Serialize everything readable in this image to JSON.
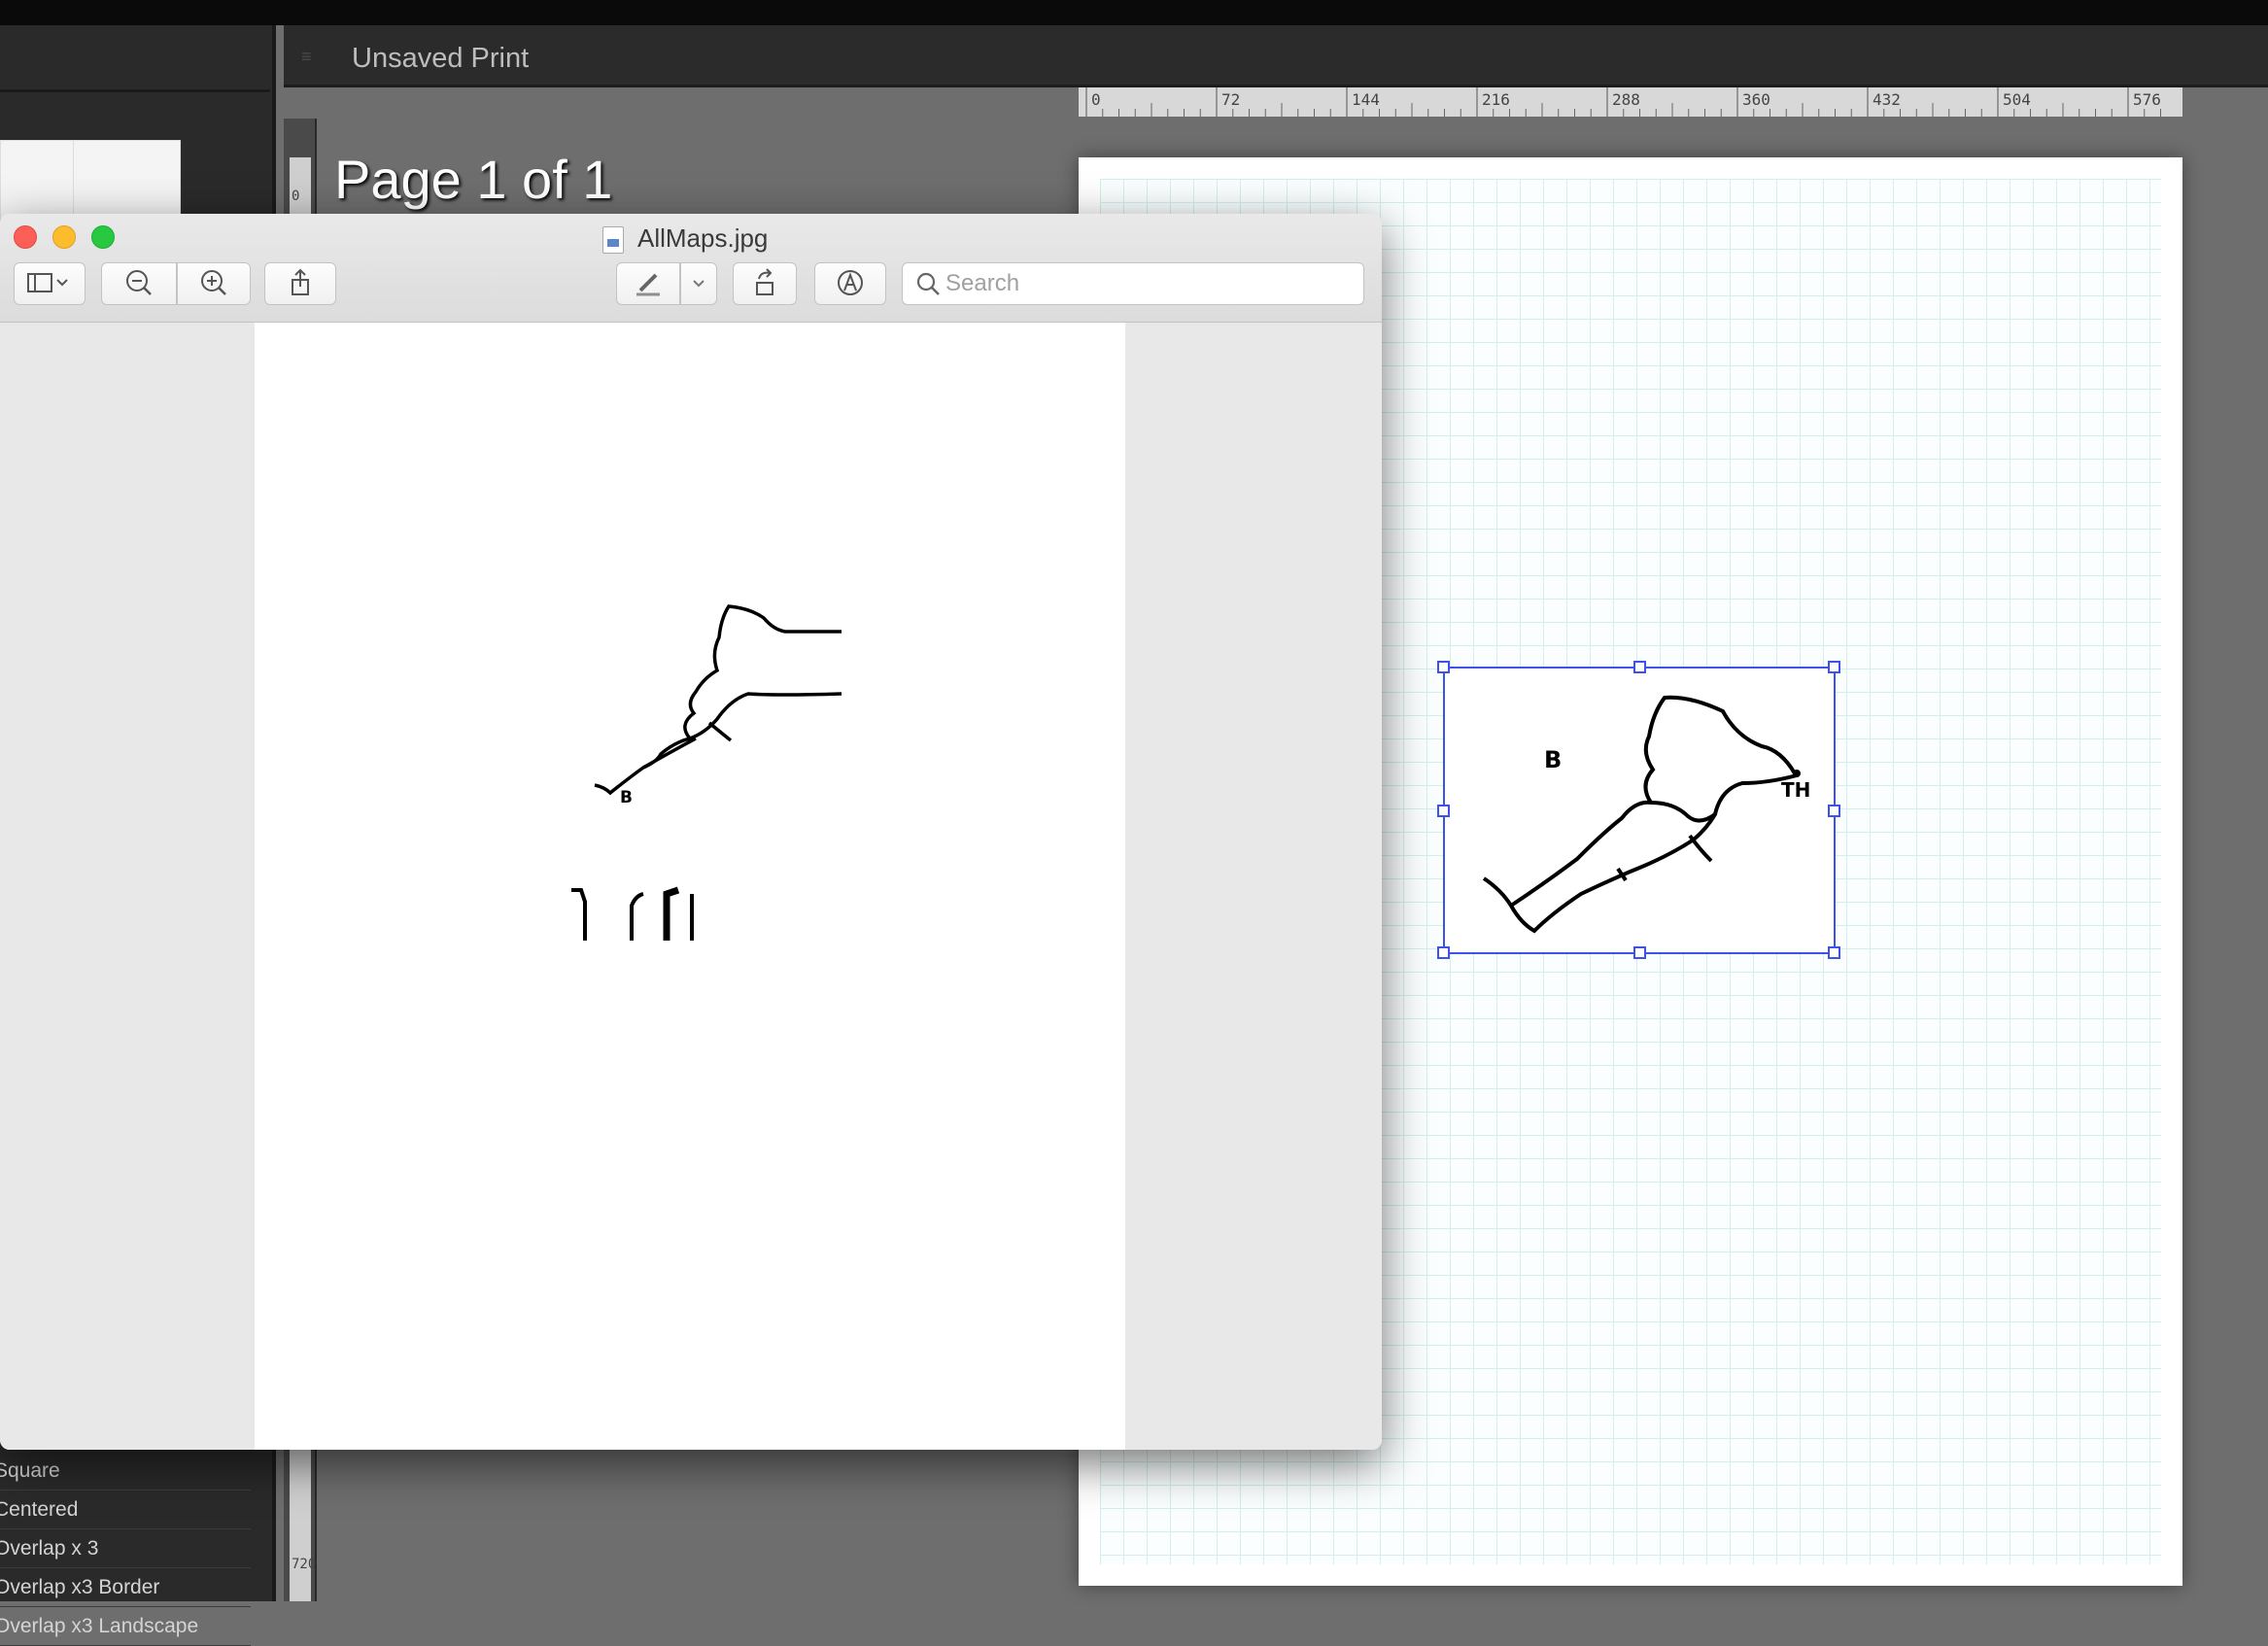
{
  "lightroom": {
    "document_title": "Unsaved Print",
    "page_label": "Page 1 of 1",
    "ruler_marks": [
      "0",
      "72",
      "144",
      "216",
      "288",
      "360",
      "432",
      "504",
      "576"
    ],
    "vertical_ruler_marks": [
      "0",
      "720"
    ],
    "template_list": [
      "Square",
      "Centered",
      "Overlap x 3",
      "Overlap x3 Border",
      "Overlap x3 Landscape"
    ],
    "print_preview_map": {
      "labels": [
        "B",
        "TH"
      ]
    }
  },
  "preview_window": {
    "filename": "AllMaps.jpg",
    "toolbar": {
      "sidebar_label": "sidebar-toggle",
      "zoom_out_label": "zoom-out",
      "zoom_in_label": "zoom-in",
      "share_label": "share",
      "markup_label": "highlight",
      "rotate_label": "rotate",
      "annotate_label": "markup"
    },
    "search": {
      "placeholder": "Search",
      "value": ""
    },
    "image_labels": [
      "B"
    ]
  },
  "colors": {
    "selection_blue": "#3d52e8",
    "close": "#fc5f57",
    "minimize": "#fdbc2e",
    "zoom": "#28c840"
  }
}
